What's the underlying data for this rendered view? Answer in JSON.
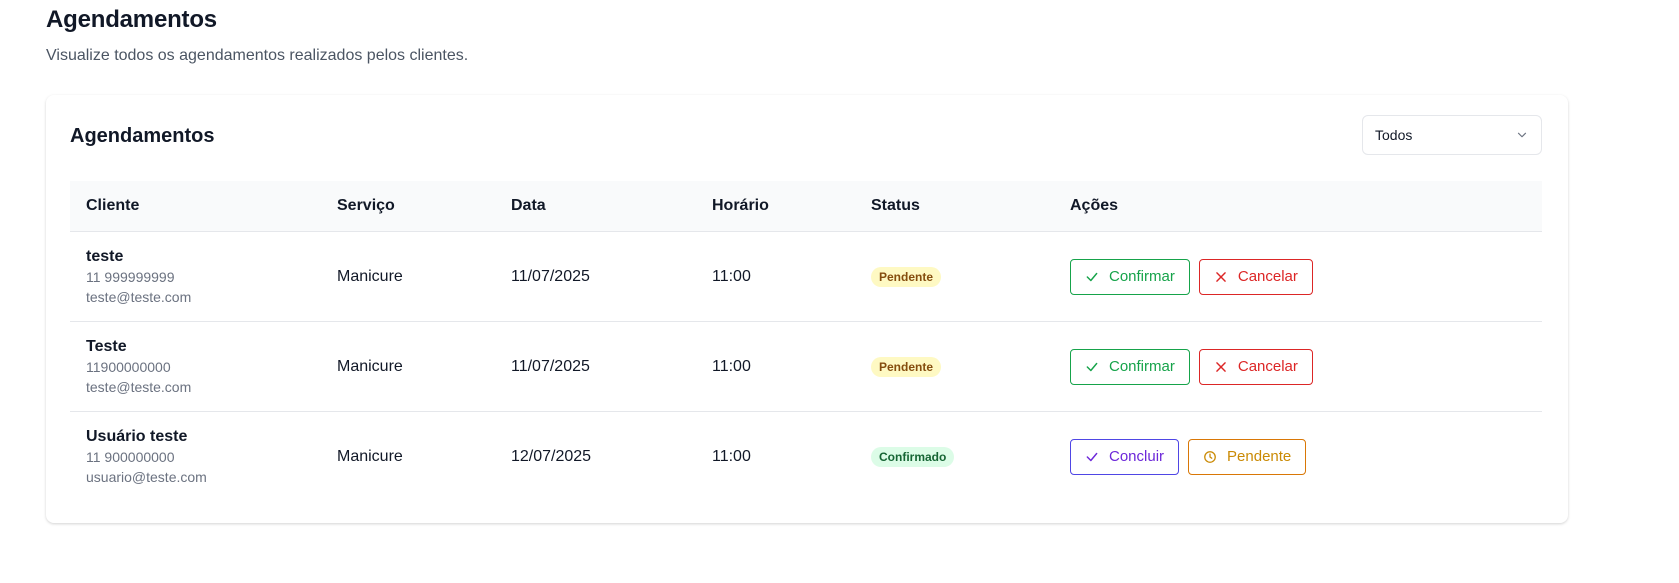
{
  "header": {
    "title": "Agendamentos",
    "subtitle": "Visualize todos os agendamentos realizados pelos clientes."
  },
  "card": {
    "title": "Agendamentos",
    "filter": {
      "selected": "Todos",
      "icon": "chevron-down-icon"
    }
  },
  "table": {
    "columns": [
      "Cliente",
      "Serviço",
      "Data",
      "Horário",
      "Status",
      "Ações"
    ],
    "rows": [
      {
        "name": "teste",
        "phone": "11 999999999",
        "email": "teste@teste.com",
        "service": "Manicure",
        "date": "11/07/2025",
        "time": "11:00",
        "status": "Pendente",
        "actions": [
          {
            "label": "Confirmar",
            "icon": "check-icon"
          },
          {
            "label": "Cancelar",
            "icon": "close-icon"
          }
        ]
      },
      {
        "name": "Teste",
        "phone": "11900000000",
        "email": "teste@teste.com",
        "service": "Manicure",
        "date": "11/07/2025",
        "time": "11:00",
        "status": "Pendente",
        "actions": [
          {
            "label": "Confirmar",
            "icon": "check-icon"
          },
          {
            "label": "Cancelar",
            "icon": "close-icon"
          }
        ]
      },
      {
        "name": "Usuário teste",
        "phone": "11 900000000",
        "email": "usuario@teste.com",
        "service": "Manicure",
        "date": "12/07/2025",
        "time": "11:00",
        "status": "Confirmado",
        "actions": [
          {
            "label": "Concluir",
            "icon": "check-icon"
          },
          {
            "label": "Pendente",
            "icon": "clock-icon"
          }
        ]
      }
    ]
  },
  "colors": {
    "confirm": "#16a34a",
    "cancel": "#dc2626",
    "complete": "#6d28d9",
    "pending_action": "#ca8a04",
    "badge_pending_bg": "#fef9c3",
    "badge_confirmed_bg": "#dcfce7"
  }
}
